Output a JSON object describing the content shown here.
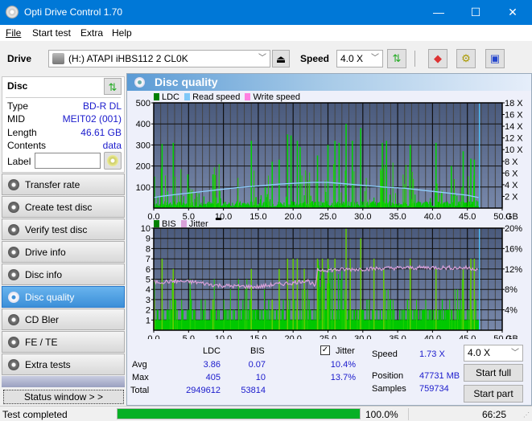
{
  "window": {
    "title": "Opti Drive Control 1.70",
    "minimize": "—",
    "maximize": "☐",
    "close": "✕"
  },
  "menu": [
    "File",
    "Start test",
    "Extra",
    "Help"
  ],
  "toolbar": {
    "drive_label": "Drive",
    "drive_value": "(H:)  ATAPI iHBS112  2 CL0K",
    "speed_label": "Speed",
    "speed_value": "4.0 X"
  },
  "disc": {
    "header": "Disc",
    "fields": [
      {
        "key": "Type",
        "value": "BD-R DL"
      },
      {
        "key": "MID",
        "value": "MEIT02 (001)"
      },
      {
        "key": "Length",
        "value": "46.61 GB"
      },
      {
        "key": "Contents",
        "value": "data"
      }
    ],
    "label_key": "Label",
    "label_value": ""
  },
  "nav": [
    {
      "label": "Transfer rate",
      "active": false
    },
    {
      "label": "Create test disc",
      "active": false
    },
    {
      "label": "Verify test disc",
      "active": false
    },
    {
      "label": "Drive info",
      "active": false
    },
    {
      "label": "Disc info",
      "active": false
    },
    {
      "label": "Disc quality",
      "active": true
    },
    {
      "label": "CD Bler",
      "active": false
    },
    {
      "label": "FE / TE",
      "active": false
    },
    {
      "label": "Extra tests",
      "active": false
    }
  ],
  "status_window_label": "Status window > >",
  "panel_title": "Disc quality",
  "chart_data": [
    {
      "type": "bar",
      "title": "LDC / Read speed",
      "legend": [
        {
          "name": "LDC",
          "color": "#00aa00"
        },
        {
          "name": "Read speed",
          "color": "#7fc8f8"
        },
        {
          "name": "Write speed",
          "color": "#ff80e0"
        }
      ],
      "xlabel": "GB",
      "xlim": [
        0,
        50
      ],
      "x_ticks": [
        "0.0",
        "5.0",
        "10.0",
        "15.0",
        "20.0",
        "25.0",
        "30.0",
        "35.0",
        "40.0",
        "45.0",
        "50.0"
      ],
      "ylim": [
        0,
        500
      ],
      "y_ticks": [
        "100",
        "200",
        "300",
        "400",
        "500"
      ],
      "y2lim": [
        0,
        18
      ],
      "y2_ticks": [
        "2 X",
        "4 X",
        "6 X",
        "8 X",
        "10 X",
        "12 X",
        "14 X",
        "16 X",
        "18 X"
      ],
      "data_end_gb": 46.61,
      "ldc_peaks": [
        [
          0.1,
          150
        ],
        [
          1.2,
          305
        ],
        [
          2.8,
          310
        ],
        [
          4.9,
          160
        ],
        [
          8.5,
          160
        ],
        [
          14.0,
          320
        ],
        [
          16.0,
          100
        ],
        [
          17.0,
          220
        ],
        [
          18.0,
          230
        ],
        [
          19.2,
          350
        ],
        [
          19.7,
          345
        ],
        [
          20.6,
          320
        ],
        [
          21.0,
          290
        ],
        [
          23.5,
          250
        ],
        [
          25.0,
          300
        ],
        [
          26.0,
          320
        ],
        [
          26.6,
          310
        ],
        [
          27.6,
          400
        ],
        [
          28.5,
          320
        ],
        [
          29.7,
          380
        ],
        [
          32.8,
          310
        ],
        [
          33.4,
          320
        ],
        [
          36.8,
          300
        ],
        [
          40.5,
          310
        ],
        [
          42.7,
          200
        ],
        [
          44.4,
          270
        ],
        [
          45.5,
          235
        ],
        [
          46.0,
          230
        ]
      ],
      "read_speed": [
        [
          0,
          1.8
        ],
        [
          1,
          2.0
        ],
        [
          3,
          2.3
        ],
        [
          6,
          2.7
        ],
        [
          9,
          3.1
        ],
        [
          12,
          3.5
        ],
        [
          15,
          3.8
        ],
        [
          18,
          4.1
        ],
        [
          21,
          4.3
        ],
        [
          23,
          4.4
        ],
        [
          25,
          4.4
        ],
        [
          27,
          4.2
        ],
        [
          30,
          3.9
        ],
        [
          33,
          3.6
        ],
        [
          36,
          3.4
        ],
        [
          39,
          3.0
        ],
        [
          42,
          2.6
        ],
        [
          45,
          2.2
        ],
        [
          46.6,
          1.8
        ]
      ]
    },
    {
      "type": "bar",
      "title": "BIS / Jitter",
      "legend": [
        {
          "name": "BIS",
          "color": "#00aa00"
        },
        {
          "name": "Jitter",
          "color": "#d8a0d8"
        }
      ],
      "xlabel": "GB",
      "xlim": [
        0,
        50
      ],
      "x_ticks": [
        "0.0",
        "5.0",
        "10.0",
        "15.0",
        "20.0",
        "25.0",
        "30.0",
        "35.0",
        "40.0",
        "45.0",
        "50.0"
      ],
      "ylim": [
        0,
        10
      ],
      "y_ticks": [
        "1",
        "2",
        "3",
        "4",
        "5",
        "6",
        "7",
        "8",
        "9",
        "10"
      ],
      "y2lim": [
        0,
        20
      ],
      "y2_ticks": [
        "4%",
        "8%",
        "12%",
        "16%",
        "20%"
      ],
      "data_end_gb": 46.61,
      "bis_peaks": [
        [
          0.1,
          3
        ],
        [
          1.2,
          7
        ],
        [
          2.8,
          6
        ],
        [
          8.5,
          3
        ],
        [
          14.0,
          6
        ],
        [
          17.0,
          3
        ],
        [
          18.0,
          6
        ],
        [
          19.2,
          7
        ],
        [
          20.0,
          7
        ],
        [
          20.6,
          7
        ],
        [
          21.6,
          6
        ],
        [
          23.5,
          7
        ],
        [
          24.2,
          7
        ],
        [
          25.0,
          7
        ],
        [
          26.0,
          7
        ],
        [
          27.6,
          10
        ],
        [
          28.2,
          7
        ],
        [
          29.7,
          9
        ],
        [
          31.6,
          7
        ],
        [
          33.0,
          6
        ],
        [
          36.8,
          7
        ],
        [
          40.5,
          6
        ],
        [
          44.4,
          6
        ],
        [
          45.5,
          7
        ],
        [
          46.0,
          7
        ]
      ],
      "jitter": [
        [
          0,
          9.4
        ],
        [
          3,
          9.6
        ],
        [
          6,
          9.4
        ],
        [
          9,
          8.8
        ],
        [
          12,
          8.6
        ],
        [
          15,
          8.5
        ],
        [
          17,
          8.9
        ],
        [
          20,
          9.3
        ],
        [
          22,
          9.8
        ],
        [
          23.2,
          8.6
        ],
        [
          23.5,
          11.8
        ],
        [
          25,
          11.8
        ],
        [
          30,
          12.0
        ],
        [
          35,
          12.2
        ],
        [
          40,
          12.3
        ],
        [
          45,
          12.2
        ],
        [
          46.6,
          12.0
        ]
      ]
    }
  ],
  "stats": {
    "col_ldc": "LDC",
    "col_bis": "BIS",
    "jitter_label": "Jitter",
    "jitter_checked": true,
    "rows": [
      {
        "label": "Avg",
        "ldc": "3.86",
        "bis": "0.07",
        "jitter": "10.4%"
      },
      {
        "label": "Max",
        "ldc": "405",
        "bis": "10",
        "jitter": "13.7%"
      },
      {
        "label": "Total",
        "ldc": "2949612",
        "bis": "53814",
        "jitter": ""
      }
    ],
    "speed_label": "Speed",
    "speed_value": "1.73 X",
    "position_label": "Position",
    "position_value": "47731 MB",
    "samples_label": "Samples",
    "samples_value": "759734",
    "speed_select": "4.0 X",
    "start_full": "Start full",
    "start_part": "Start part"
  },
  "statusbar": {
    "text": "Test completed",
    "progress": 100.0,
    "progress_text": "100.0%",
    "time": "66:25"
  }
}
